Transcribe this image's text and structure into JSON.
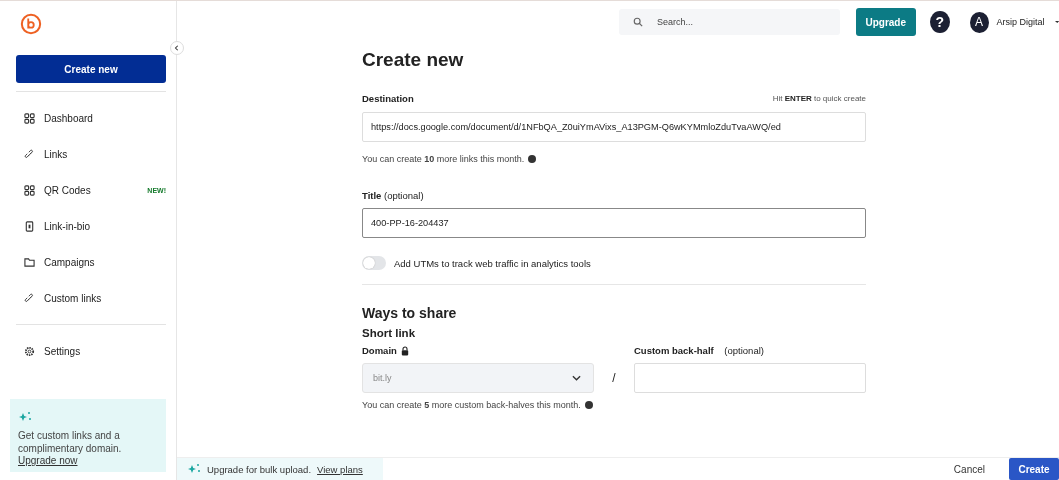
{
  "sidebar": {
    "create_button": "Create new",
    "items": [
      {
        "label": "Dashboard",
        "kind": "grid",
        "selected": false
      },
      {
        "label": "Links",
        "kind": "link",
        "selected": false
      },
      {
        "label": "QR Codes",
        "kind": "qr",
        "badge": "NEW!",
        "selected": false
      },
      {
        "label": "Link-in-bio",
        "kind": "phone",
        "selected": false
      },
      {
        "label": "Campaigns",
        "kind": "folder",
        "selected": false
      },
      {
        "label": "Custom links",
        "kind": "link",
        "selected": false
      }
    ],
    "settings": {
      "label": "Settings",
      "selected": false
    },
    "promo": {
      "text": "Get custom links and a complimentary domain.",
      "link": "Upgrade now"
    }
  },
  "topbar": {
    "search": {
      "placeholder": "Search..."
    },
    "upgrade_button": "Upgrade",
    "help": "?",
    "user": {
      "initial": "A",
      "name": "Arsip Digital"
    }
  },
  "form": {
    "title": "Create new",
    "destination": {
      "label": "Destination",
      "hint_prefix": "Hit",
      "hint_key": "ENTER",
      "hint_suffix": "to quick create",
      "value": "https://docs.google.com/document/d/1NFbQA_Z0uiYmAVixs_A13PGM-Q6wKYMmloZduTvaAWQ/ed",
      "note": "You can create **10** more links this month."
    },
    "title_field": {
      "label": "Title",
      "optional": "(optional)",
      "value": "400-PP-16-204437"
    },
    "utm_toggle": {
      "label": "Add UTMs to track web traffic in analytics tools",
      "on": false
    },
    "share": {
      "heading": "Ways to share",
      "subheading": "Short link",
      "domain_label": "Domain",
      "domain_value": "bit.ly",
      "slash": "/",
      "backhalf_label": "Custom back-half",
      "backhalf_optional": "(optional)",
      "note": "You can create **5** more custom back-halves this month."
    }
  },
  "footer": {
    "text": "Upgrade for bulk upload.",
    "link": "View plans",
    "cancel": "Cancel",
    "create": "Create"
  }
}
